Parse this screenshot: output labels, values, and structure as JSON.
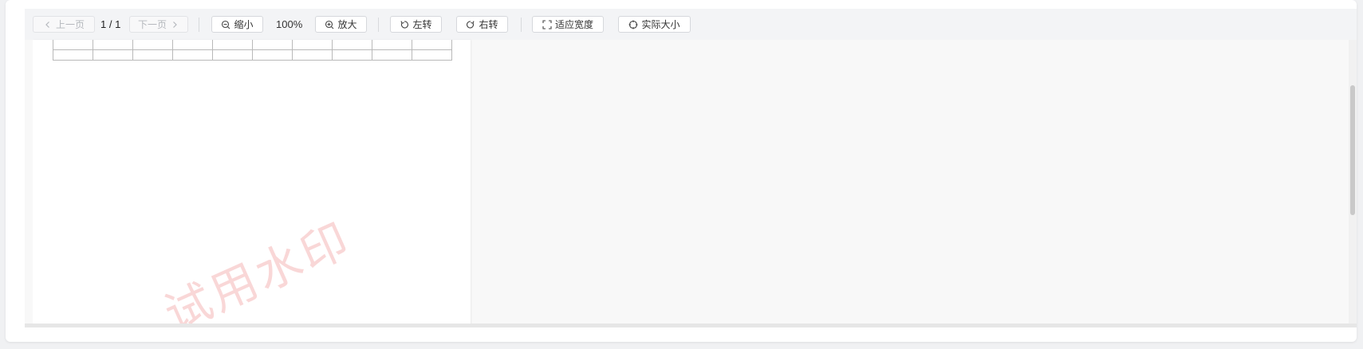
{
  "toolbar": {
    "prev_label": "上一页",
    "page_indicator": "1 / 1",
    "next_label": "下一页",
    "zoom_out_label": "缩小",
    "zoom_value": "100%",
    "zoom_in_label": "放大",
    "rotate_left_label": "左转",
    "rotate_right_label": "右转",
    "fit_width_label": "适应宽度",
    "actual_size_label": "实际大小"
  },
  "document": {
    "watermark": "试用水印",
    "table_columns": 10,
    "table_rows_visible": 2
  },
  "colors": {
    "toolbar_bg": "#f3f4f6",
    "viewer_bg": "#f8f8f8",
    "watermark": "#e87070"
  },
  "icons": [
    "chevron-left-icon",
    "chevron-right-icon",
    "zoom-out-icon",
    "zoom-in-icon",
    "rotate-left-icon",
    "rotate-right-icon",
    "fit-width-icon",
    "actual-size-icon"
  ]
}
